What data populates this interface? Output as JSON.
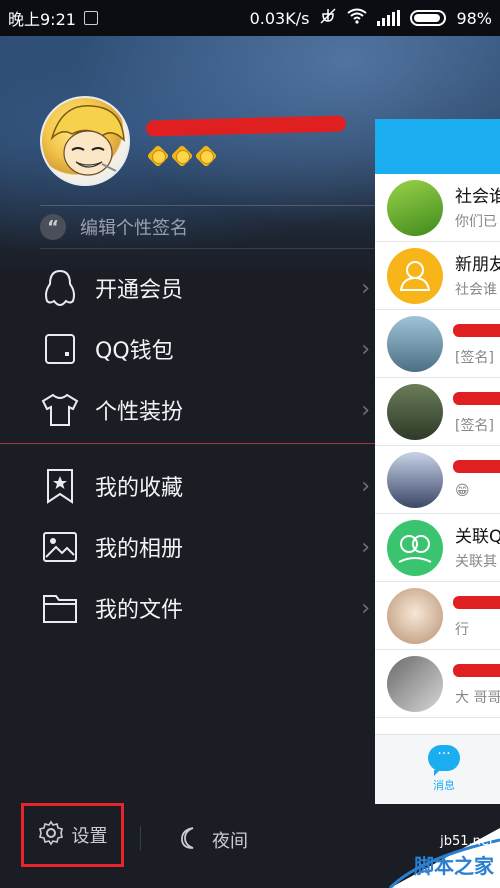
{
  "status_bar": {
    "time": "晚上9:21",
    "net_speed": "0.03K/s",
    "battery": "98%"
  },
  "profile": {
    "signature_placeholder": "编辑个性签名"
  },
  "menu": {
    "items": [
      {
        "label": "开通会员"
      },
      {
        "label": "QQ钱包"
      },
      {
        "label": "个性装扮"
      },
      {
        "label": "我的收藏"
      },
      {
        "label": "我的相册"
      },
      {
        "label": "我的文件"
      }
    ]
  },
  "chat_preview": {
    "rows": [
      {
        "title": "社会谁",
        "subtitle": "你们已"
      },
      {
        "title": "新朋友",
        "subtitle": "社会谁"
      },
      {
        "title": "",
        "subtitle": "[签名]"
      },
      {
        "title": "",
        "subtitle": "[签名]"
      },
      {
        "title": "",
        "subtitle": "😁"
      },
      {
        "title": "关联Q",
        "subtitle": "关联其"
      },
      {
        "title": "",
        "subtitle": "行"
      },
      {
        "title": "",
        "subtitle": "大 哥哥"
      }
    ],
    "tab_messages": "消息"
  },
  "bottom_bar": {
    "settings": "设置",
    "night": "夜间"
  },
  "watermark": {
    "site": "jb51.net",
    "cn": "脚本之家"
  },
  "colors": {
    "accent_blue": "#1aaef0",
    "highlight_red": "#e8232c",
    "drawer_bg": "#1b1d24"
  }
}
